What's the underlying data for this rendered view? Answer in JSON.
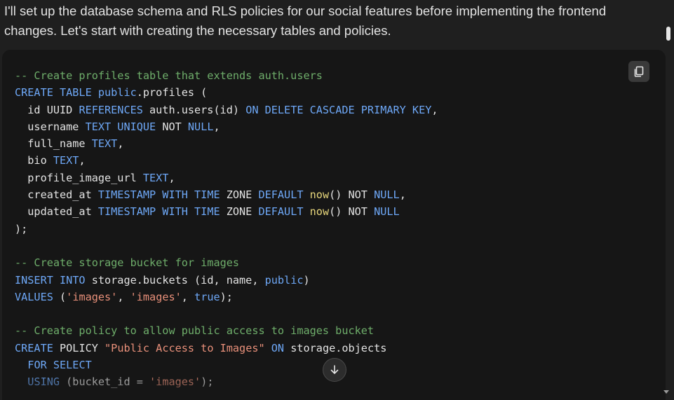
{
  "message": {
    "intro": "I'll set up the database schema and RLS policies for our social features before implementing the frontend changes. Let's start with creating the necessary tables and policies."
  },
  "code": {
    "lines": [
      [
        {
          "t": "-- Create profiles table that extends auth.users",
          "c": "comment"
        }
      ],
      [
        {
          "t": "CREATE TABLE ",
          "c": "keyword"
        },
        {
          "t": "public",
          "c": "keyword"
        },
        {
          "t": ".profiles (",
          "c": "plain"
        }
      ],
      [
        {
          "t": "  id UUID ",
          "c": "plain"
        },
        {
          "t": "REFERENCES",
          "c": "keyword"
        },
        {
          "t": " auth.users(id) ",
          "c": "plain"
        },
        {
          "t": "ON DELETE CASCADE PRIMARY KEY",
          "c": "keyword"
        },
        {
          "t": ",",
          "c": "plain"
        }
      ],
      [
        {
          "t": "  username ",
          "c": "plain"
        },
        {
          "t": "TEXT UNIQUE",
          "c": "keyword"
        },
        {
          "t": " NOT ",
          "c": "plain"
        },
        {
          "t": "NULL",
          "c": "keyword"
        },
        {
          "t": ",",
          "c": "plain"
        }
      ],
      [
        {
          "t": "  full_name ",
          "c": "plain"
        },
        {
          "t": "TEXT",
          "c": "keyword"
        },
        {
          "t": ",",
          "c": "plain"
        }
      ],
      [
        {
          "t": "  bio ",
          "c": "plain"
        },
        {
          "t": "TEXT",
          "c": "keyword"
        },
        {
          "t": ",",
          "c": "plain"
        }
      ],
      [
        {
          "t": "  profile_image_url ",
          "c": "plain"
        },
        {
          "t": "TEXT",
          "c": "keyword"
        },
        {
          "t": ",",
          "c": "plain"
        }
      ],
      [
        {
          "t": "  created_at ",
          "c": "plain"
        },
        {
          "t": "TIMESTAMP WITH TIME",
          "c": "keyword"
        },
        {
          "t": " ZONE ",
          "c": "plain"
        },
        {
          "t": "DEFAULT",
          "c": "keyword"
        },
        {
          "t": " ",
          "c": "plain"
        },
        {
          "t": "now",
          "c": "func"
        },
        {
          "t": "() NOT ",
          "c": "plain"
        },
        {
          "t": "NULL",
          "c": "keyword"
        },
        {
          "t": ",",
          "c": "plain"
        }
      ],
      [
        {
          "t": "  updated_at ",
          "c": "plain"
        },
        {
          "t": "TIMESTAMP WITH TIME",
          "c": "keyword"
        },
        {
          "t": " ZONE ",
          "c": "plain"
        },
        {
          "t": "DEFAULT",
          "c": "keyword"
        },
        {
          "t": " ",
          "c": "plain"
        },
        {
          "t": "now",
          "c": "func"
        },
        {
          "t": "() NOT ",
          "c": "plain"
        },
        {
          "t": "NULL",
          "c": "keyword"
        }
      ],
      [
        {
          "t": ");",
          "c": "plain"
        }
      ],
      [],
      [
        {
          "t": "-- Create storage bucket for images",
          "c": "comment"
        }
      ],
      [
        {
          "t": "INSERT INTO",
          "c": "keyword"
        },
        {
          "t": " storage.buckets (id, name, ",
          "c": "plain"
        },
        {
          "t": "public",
          "c": "keyword"
        },
        {
          "t": ")",
          "c": "plain"
        }
      ],
      [
        {
          "t": "VALUES",
          "c": "keyword"
        },
        {
          "t": " (",
          "c": "plain"
        },
        {
          "t": "'images'",
          "c": "string"
        },
        {
          "t": ", ",
          "c": "plain"
        },
        {
          "t": "'images'",
          "c": "string"
        },
        {
          "t": ", ",
          "c": "plain"
        },
        {
          "t": "true",
          "c": "keyword"
        },
        {
          "t": ");",
          "c": "plain"
        }
      ],
      [],
      [
        {
          "t": "-- Create policy to allow public access to images bucket",
          "c": "comment"
        }
      ],
      [
        {
          "t": "CREATE",
          "c": "keyword"
        },
        {
          "t": " POLICY ",
          "c": "plain"
        },
        {
          "t": "\"Public Access to Images\"",
          "c": "string"
        },
        {
          "t": " ",
          "c": "plain"
        },
        {
          "t": "ON",
          "c": "keyword"
        },
        {
          "t": " storage.objects",
          "c": "plain"
        }
      ],
      [
        {
          "t": "  ",
          "c": "plain"
        },
        {
          "t": "FOR SELECT",
          "c": "keyword"
        }
      ],
      [
        {
          "t": "  ",
          "c": "plain"
        },
        {
          "t": "USING",
          "c": "keyword"
        },
        {
          "t": " (bucket_id = ",
          "c": "plain"
        },
        {
          "t": "'images'",
          "c": "string"
        },
        {
          "t": ");",
          "c": "plain"
        }
      ]
    ]
  },
  "controls": {
    "copy_icon": "copy-icon",
    "scroll_down_icon": "arrow-down-icon"
  },
  "colors": {
    "background": "#1f1f1f",
    "code_background": "#161616",
    "comment": "#6ead6a",
    "keyword": "#6ea8f7",
    "string": "#e9907a",
    "function": "#e8d77c",
    "text": "#e3e3e3"
  }
}
